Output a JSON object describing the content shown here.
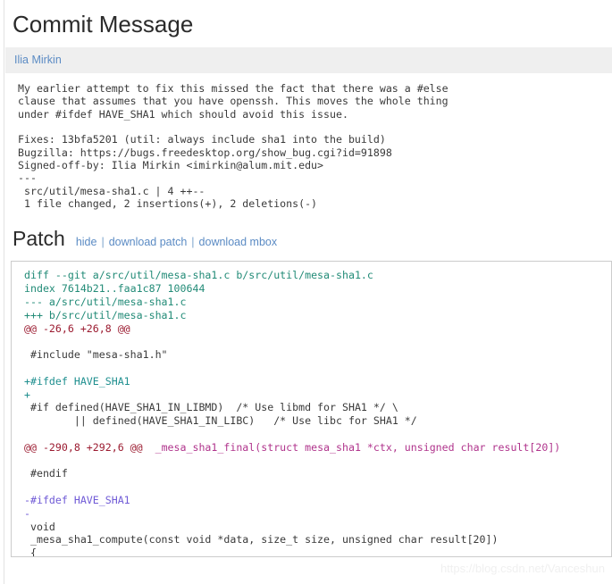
{
  "commit_section": {
    "title": "Commit Message",
    "author": "Ilia Mirkin",
    "body": "My earlier attempt to fix this missed the fact that there was a #else\nclause that assumes that you have openssh. This moves the whole thing\nunder #ifdef HAVE_SHA1 which should avoid this issue.\n\nFixes: 13bfa5201 (util: always include sha1 into the build)\nBugzilla: https://bugs.freedesktop.org/show_bug.cgi?id=91898\nSigned-off-by: Ilia Mirkin <imirkin@alum.mit.edu>\n---\n src/util/mesa-sha1.c | 4 ++--\n 1 file changed, 2 insertions(+), 2 deletions(-)"
  },
  "patch_section": {
    "title": "Patch",
    "links": {
      "hide": "hide",
      "download_patch": "download patch",
      "download_mbox": "download mbox",
      "separator": "|"
    },
    "diff_lines": [
      {
        "kind": "meta",
        "text": "diff --git a/src/util/mesa-sha1.c b/src/util/mesa-sha1.c"
      },
      {
        "kind": "meta",
        "text": "index 7614b21..faa1c87 100644"
      },
      {
        "kind": "meta",
        "text": "--- a/src/util/mesa-sha1.c"
      },
      {
        "kind": "meta",
        "text": "+++ b/src/util/mesa-sha1.c"
      },
      {
        "kind": "hunk",
        "marker": "@@ -26,6 +26,8 @@",
        "func": ""
      },
      {
        "kind": "ctx",
        "text": ""
      },
      {
        "kind": "ctx",
        "text": " #include \"mesa-sha1.h\""
      },
      {
        "kind": "ctx",
        "text": ""
      },
      {
        "kind": "add",
        "text": "+#ifdef HAVE_SHA1"
      },
      {
        "kind": "add",
        "text": "+"
      },
      {
        "kind": "ctx",
        "text": " #if defined(HAVE_SHA1_IN_LIBMD)  /* Use libmd for SHA1 */ \\"
      },
      {
        "kind": "ctx",
        "text": "        || defined(HAVE_SHA1_IN_LIBC)   /* Use libc for SHA1 */"
      },
      {
        "kind": "ctx",
        "text": ""
      },
      {
        "kind": "hunk",
        "marker": "@@ -290,8 +292,6 @@",
        "func": "_mesa_sha1_final(struct mesa_sha1 *ctx, unsigned char result[20])"
      },
      {
        "kind": "ctx",
        "text": ""
      },
      {
        "kind": "ctx",
        "text": " #endif"
      },
      {
        "kind": "ctx",
        "text": ""
      },
      {
        "kind": "del",
        "text": "-#ifdef HAVE_SHA1"
      },
      {
        "kind": "del",
        "text": "-"
      },
      {
        "kind": "ctx",
        "text": " void"
      },
      {
        "kind": "ctx",
        "text": " _mesa_sha1_compute(const void *data, size_t size, unsigned char result[20])"
      },
      {
        "kind": "ctx",
        "text": " {"
      }
    ]
  },
  "watermark": {
    "text": "https://blog.csdn.net/Vanceshun"
  },
  "colors": {
    "link": "#5b8bc4",
    "author_bar_bg": "#efefef",
    "diff_meta": "#228b77",
    "diff_hunk": "#9b1b30",
    "diff_func": "#b0348c",
    "diff_add": "#1f8f8f",
    "diff_del": "#6f5ad6",
    "diff_border": "#cccccc",
    "watermark": "#f0f0f0"
  }
}
